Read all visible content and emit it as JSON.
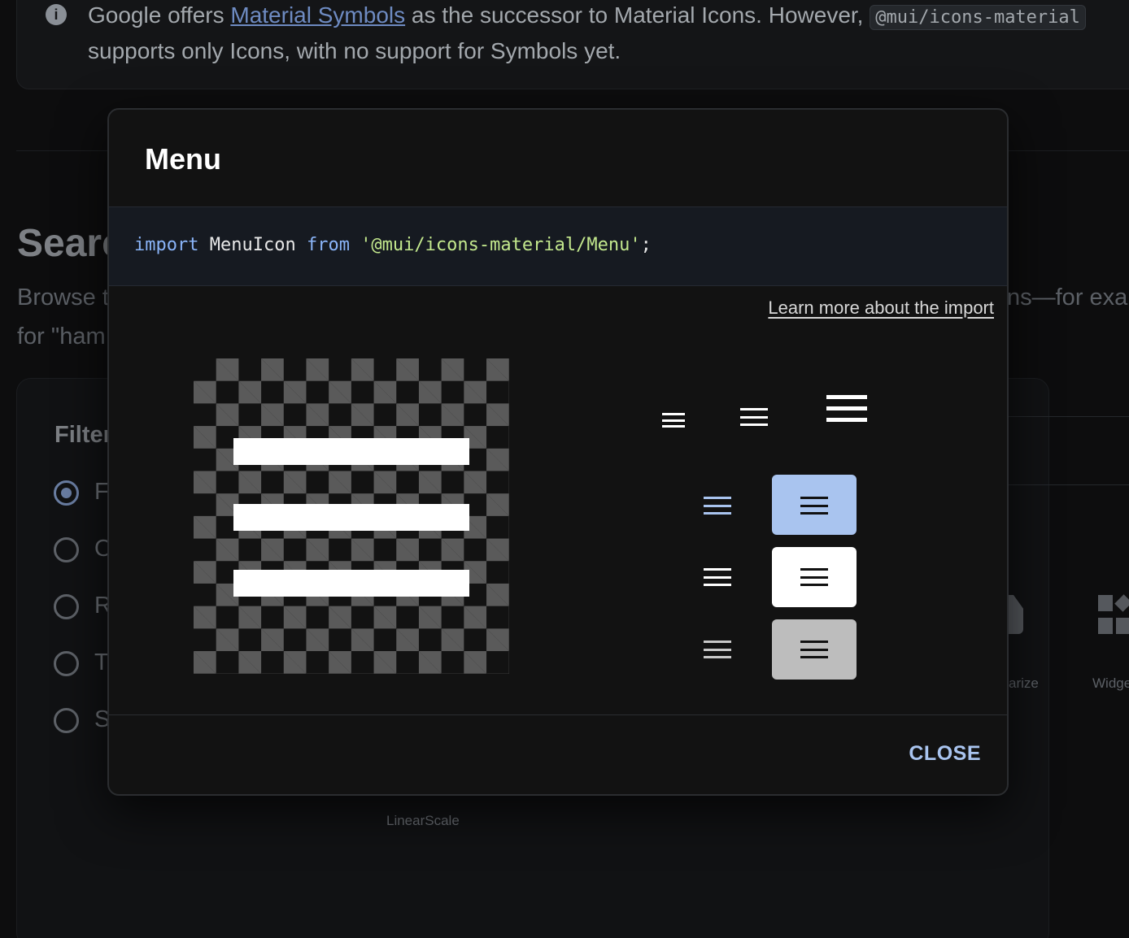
{
  "background": {
    "callout": {
      "prefix": "Google offers",
      "link": "Material Symbols",
      "suffix": "as the successor to Material Icons. However,",
      "code": "@mui/icons-material",
      "line2": "supports only Icons, with no support for Symbols yet."
    },
    "section_title": "Searc",
    "description_line1": "Browse t",
    "description_line2": "for \"ham",
    "description_right": "ns—for exam",
    "filter_title": "Filter",
    "filter_options": [
      "F",
      "O",
      "R",
      "T",
      "S"
    ],
    "icon_labels": {
      "arize": "arize",
      "widge": "Widge",
      "linear": "LinearScale"
    }
  },
  "modal": {
    "title": "Menu",
    "code": {
      "kw1": "import",
      "name": "MenuIcon",
      "kw2": "from",
      "path": "'@mui/icons-material/Menu'",
      "end": ";"
    },
    "learn_more": "Learn more about the import",
    "close_label": "CLOSE",
    "colors": {
      "primary": "#a9c4ef",
      "background": "#121212",
      "tile_grey": "#bdbdbd"
    },
    "icons": {
      "main": "menu-icon",
      "sizes": [
        "small",
        "medium",
        "large"
      ],
      "variants": [
        "primary",
        "default",
        "disabled"
      ]
    }
  }
}
